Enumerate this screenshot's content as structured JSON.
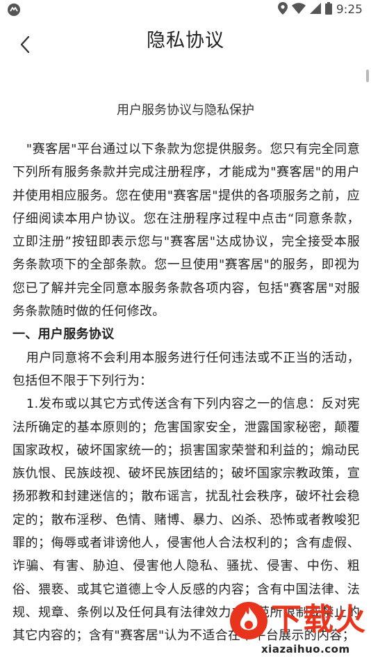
{
  "status_bar": {
    "time": "9:25",
    "icons": [
      "app-notification-icon",
      "location-icon",
      "wifi-icon",
      "cellular-signal-icon",
      "battery-icon"
    ]
  },
  "nav": {
    "title": "隐私协议",
    "back_icon": "chevron-left-icon"
  },
  "document": {
    "heading": "用户服务协议与隐私保护",
    "intro": "\"赛客居\"平台通过以下条款为您提供服务。您只有完全同意下列所有服务条款并完成注册程序，才能成为\"赛客居\"的用户并使用相应服务。您在使用\"赛客居\"提供的各项服务之前，应仔细阅读本用户协议。您在注册程序过程中点击“同意条款，立即注册”按钮即表示您与\"赛客居\"达成协议，完全接受本服务条款项下的全部条款。您一旦使用\"赛客居\"的服务，即视为您已了解并完全同意本服务条款各项内容，包括\"赛客居\"对服务条款随时做的任何修改。",
    "section1_title": "一、用户服务协议",
    "section1_p1": "用户同意将不会利用本服务进行任何违法或不正当的活动，包括但不限于下列行为：",
    "section1_item1": "1.发布或以其它方式传送含有下列内容之一的信息：反对宪法所确定的基本原则的；危害国家安全，泄露国家秘密，颠覆国家政权，破坏国家统一的；损害国家荣誉和利益的；煽动民族仇恨、民族歧视、破坏民族团结的；破坏国家宗教政策，宣扬邪教和封建迷信的；散布谣言，扰乱社会秩序，破坏社会稳定的；散布淫秽、色情、赌博、暴力、凶杀、恐怖或者教唆犯罪的；侮辱或者诽谤他人，侵害他人合法权利的；含有虚假、诈骗、有害、胁迫、侵害他人隐私、骚扰、侵害、中伤、粗俗、猥亵、或其它道德上令人反感的内容；含有中国法律、法规、规章、条例以及任何具有法律效力之规范所限制或禁止的其它内容的；含有\"赛客居\"认为不适合在本平台展示的内容；"
  },
  "watermark": {
    "brand": "下载火",
    "url": "xiazaihuo.com"
  },
  "colors": {
    "watermark_red": "#e8341c",
    "text": "#222222",
    "background": "#ffffff"
  }
}
